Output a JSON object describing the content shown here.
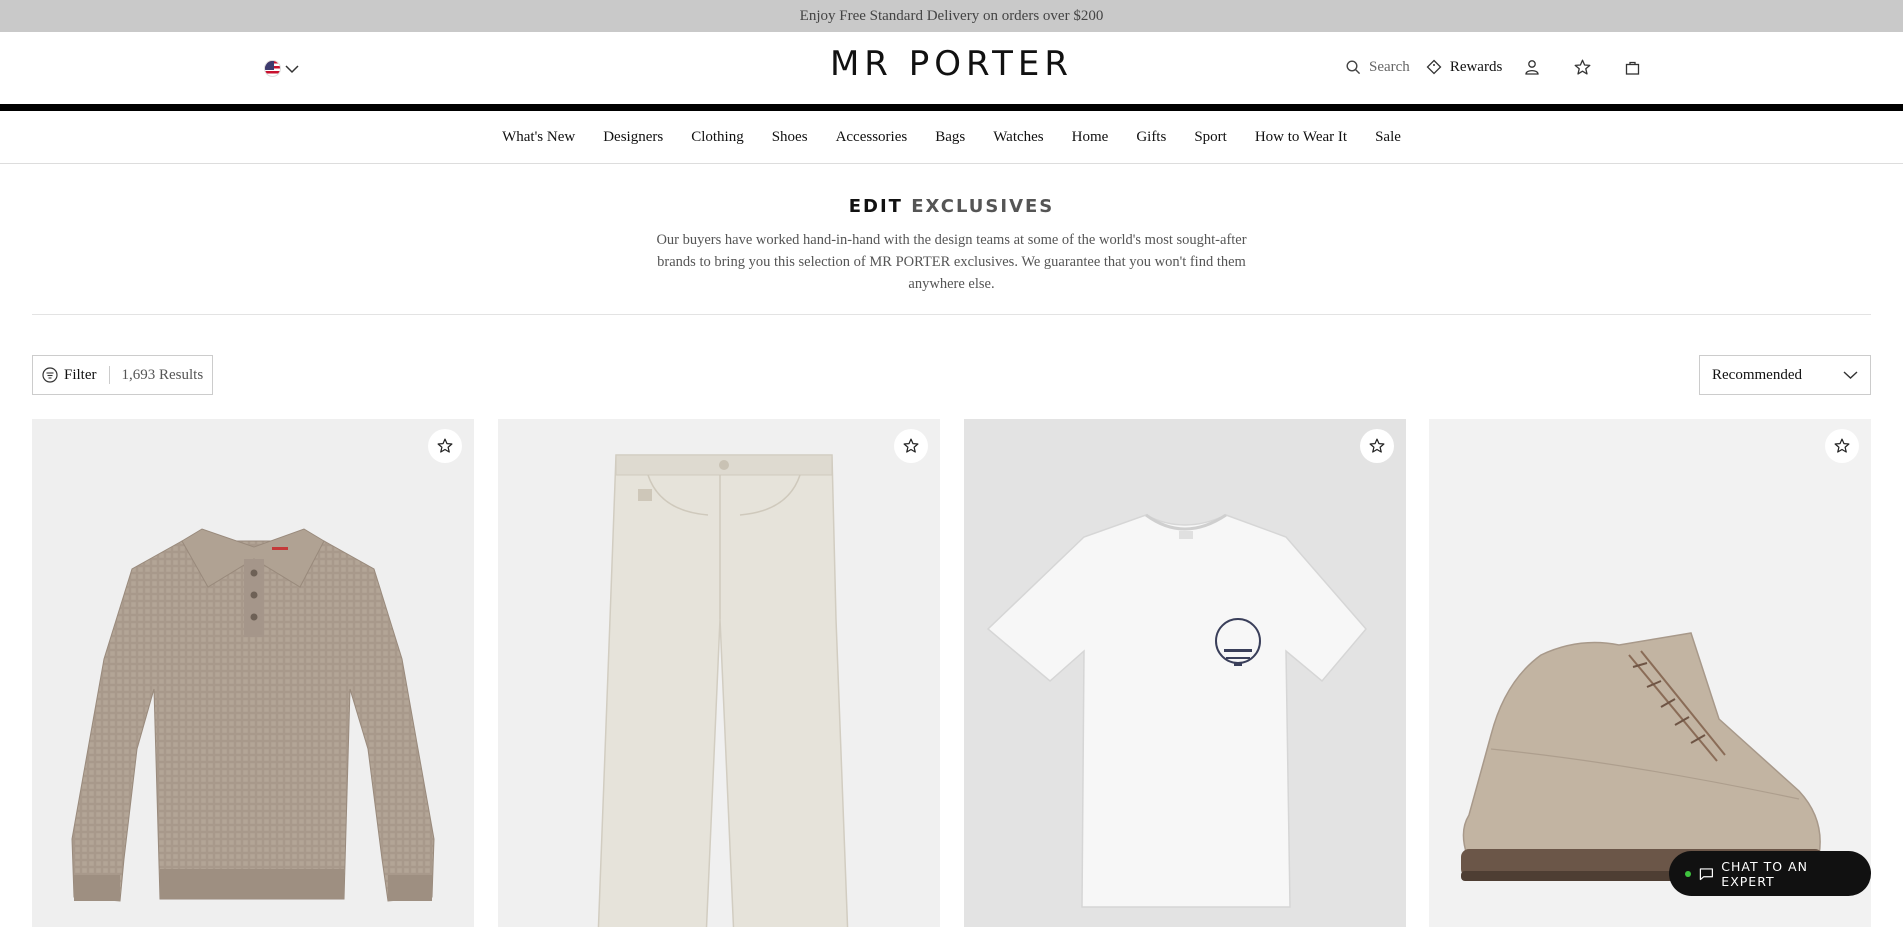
{
  "promo": {
    "text": "Enjoy Free Standard Delivery on orders over $200"
  },
  "header": {
    "country_icon": "us-flag-icon",
    "logo": "MR PORTER",
    "search_label": "Search",
    "rewards_label": "Rewards",
    "icons": [
      "search-icon",
      "rewards-diamond-icon",
      "account-icon",
      "wishlist-star-icon",
      "bag-icon"
    ]
  },
  "nav": {
    "items": [
      "What's New",
      "Designers",
      "Clothing",
      "Shoes",
      "Accessories",
      "Bags",
      "Watches",
      "Home",
      "Gifts",
      "Sport",
      "How to Wear It",
      "Sale"
    ]
  },
  "edit": {
    "title_bold": "EDIT",
    "title_light": "EXCLUSIVES",
    "description": "Our buyers have worked hand-in-hand with the design teams at some of the world's most sought-after brands to bring you this selection of MR PORTER exclusives. We guarantee that you won't find them anywhere else."
  },
  "toolbar": {
    "filter_label": "Filter",
    "results_count": "1,693 Results",
    "sort_value": "Recommended"
  },
  "products": [
    {
      "image": "knit-polo-sweater"
    },
    {
      "image": "cream-jeans"
    },
    {
      "image": "white-graphic-tshirt"
    },
    {
      "image": "suede-lace-up-boot"
    }
  ],
  "chat": {
    "label": "CHAT TO AN EXPERT",
    "status_color": "#3ec33e"
  },
  "colors": {
    "promo_bg": "#c9c9c9",
    "rule": "#000000",
    "chat_bg": "#111111"
  }
}
